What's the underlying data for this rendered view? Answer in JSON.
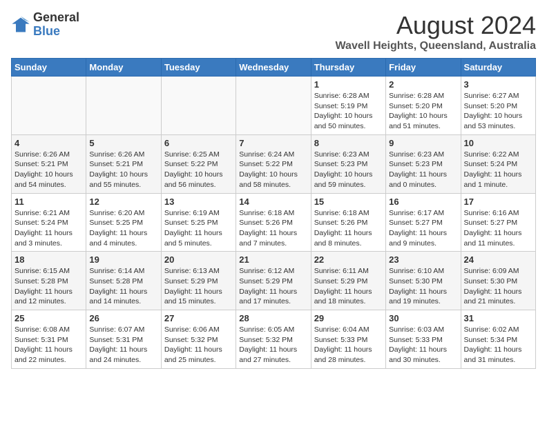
{
  "header": {
    "logo_line1": "General",
    "logo_line2": "Blue",
    "month": "August 2024",
    "location": "Wavell Heights, Queensland, Australia"
  },
  "days_of_week": [
    "Sunday",
    "Monday",
    "Tuesday",
    "Wednesday",
    "Thursday",
    "Friday",
    "Saturday"
  ],
  "weeks": [
    [
      {
        "num": "",
        "sunrise": "",
        "sunset": "",
        "daylight": ""
      },
      {
        "num": "",
        "sunrise": "",
        "sunset": "",
        "daylight": ""
      },
      {
        "num": "",
        "sunrise": "",
        "sunset": "",
        "daylight": ""
      },
      {
        "num": "",
        "sunrise": "",
        "sunset": "",
        "daylight": ""
      },
      {
        "num": "1",
        "sunrise": "Sunrise: 6:28 AM",
        "sunset": "Sunset: 5:19 PM",
        "daylight": "Daylight: 10 hours and 50 minutes."
      },
      {
        "num": "2",
        "sunrise": "Sunrise: 6:28 AM",
        "sunset": "Sunset: 5:20 PM",
        "daylight": "Daylight: 10 hours and 51 minutes."
      },
      {
        "num": "3",
        "sunrise": "Sunrise: 6:27 AM",
        "sunset": "Sunset: 5:20 PM",
        "daylight": "Daylight: 10 hours and 53 minutes."
      }
    ],
    [
      {
        "num": "4",
        "sunrise": "Sunrise: 6:26 AM",
        "sunset": "Sunset: 5:21 PM",
        "daylight": "Daylight: 10 hours and 54 minutes."
      },
      {
        "num": "5",
        "sunrise": "Sunrise: 6:26 AM",
        "sunset": "Sunset: 5:21 PM",
        "daylight": "Daylight: 10 hours and 55 minutes."
      },
      {
        "num": "6",
        "sunrise": "Sunrise: 6:25 AM",
        "sunset": "Sunset: 5:22 PM",
        "daylight": "Daylight: 10 hours and 56 minutes."
      },
      {
        "num": "7",
        "sunrise": "Sunrise: 6:24 AM",
        "sunset": "Sunset: 5:22 PM",
        "daylight": "Daylight: 10 hours and 58 minutes."
      },
      {
        "num": "8",
        "sunrise": "Sunrise: 6:23 AM",
        "sunset": "Sunset: 5:23 PM",
        "daylight": "Daylight: 10 hours and 59 minutes."
      },
      {
        "num": "9",
        "sunrise": "Sunrise: 6:23 AM",
        "sunset": "Sunset: 5:23 PM",
        "daylight": "Daylight: 11 hours and 0 minutes."
      },
      {
        "num": "10",
        "sunrise": "Sunrise: 6:22 AM",
        "sunset": "Sunset: 5:24 PM",
        "daylight": "Daylight: 11 hours and 1 minute."
      }
    ],
    [
      {
        "num": "11",
        "sunrise": "Sunrise: 6:21 AM",
        "sunset": "Sunset: 5:24 PM",
        "daylight": "Daylight: 11 hours and 3 minutes."
      },
      {
        "num": "12",
        "sunrise": "Sunrise: 6:20 AM",
        "sunset": "Sunset: 5:25 PM",
        "daylight": "Daylight: 11 hours and 4 minutes."
      },
      {
        "num": "13",
        "sunrise": "Sunrise: 6:19 AM",
        "sunset": "Sunset: 5:25 PM",
        "daylight": "Daylight: 11 hours and 5 minutes."
      },
      {
        "num": "14",
        "sunrise": "Sunrise: 6:18 AM",
        "sunset": "Sunset: 5:26 PM",
        "daylight": "Daylight: 11 hours and 7 minutes."
      },
      {
        "num": "15",
        "sunrise": "Sunrise: 6:18 AM",
        "sunset": "Sunset: 5:26 PM",
        "daylight": "Daylight: 11 hours and 8 minutes."
      },
      {
        "num": "16",
        "sunrise": "Sunrise: 6:17 AM",
        "sunset": "Sunset: 5:27 PM",
        "daylight": "Daylight: 11 hours and 9 minutes."
      },
      {
        "num": "17",
        "sunrise": "Sunrise: 6:16 AM",
        "sunset": "Sunset: 5:27 PM",
        "daylight": "Daylight: 11 hours and 11 minutes."
      }
    ],
    [
      {
        "num": "18",
        "sunrise": "Sunrise: 6:15 AM",
        "sunset": "Sunset: 5:28 PM",
        "daylight": "Daylight: 11 hours and 12 minutes."
      },
      {
        "num": "19",
        "sunrise": "Sunrise: 6:14 AM",
        "sunset": "Sunset: 5:28 PM",
        "daylight": "Daylight: 11 hours and 14 minutes."
      },
      {
        "num": "20",
        "sunrise": "Sunrise: 6:13 AM",
        "sunset": "Sunset: 5:29 PM",
        "daylight": "Daylight: 11 hours and 15 minutes."
      },
      {
        "num": "21",
        "sunrise": "Sunrise: 6:12 AM",
        "sunset": "Sunset: 5:29 PM",
        "daylight": "Daylight: 11 hours and 17 minutes."
      },
      {
        "num": "22",
        "sunrise": "Sunrise: 6:11 AM",
        "sunset": "Sunset: 5:29 PM",
        "daylight": "Daylight: 11 hours and 18 minutes."
      },
      {
        "num": "23",
        "sunrise": "Sunrise: 6:10 AM",
        "sunset": "Sunset: 5:30 PM",
        "daylight": "Daylight: 11 hours and 19 minutes."
      },
      {
        "num": "24",
        "sunrise": "Sunrise: 6:09 AM",
        "sunset": "Sunset: 5:30 PM",
        "daylight": "Daylight: 11 hours and 21 minutes."
      }
    ],
    [
      {
        "num": "25",
        "sunrise": "Sunrise: 6:08 AM",
        "sunset": "Sunset: 5:31 PM",
        "daylight": "Daylight: 11 hours and 22 minutes."
      },
      {
        "num": "26",
        "sunrise": "Sunrise: 6:07 AM",
        "sunset": "Sunset: 5:31 PM",
        "daylight": "Daylight: 11 hours and 24 minutes."
      },
      {
        "num": "27",
        "sunrise": "Sunrise: 6:06 AM",
        "sunset": "Sunset: 5:32 PM",
        "daylight": "Daylight: 11 hours and 25 minutes."
      },
      {
        "num": "28",
        "sunrise": "Sunrise: 6:05 AM",
        "sunset": "Sunset: 5:32 PM",
        "daylight": "Daylight: 11 hours and 27 minutes."
      },
      {
        "num": "29",
        "sunrise": "Sunrise: 6:04 AM",
        "sunset": "Sunset: 5:33 PM",
        "daylight": "Daylight: 11 hours and 28 minutes."
      },
      {
        "num": "30",
        "sunrise": "Sunrise: 6:03 AM",
        "sunset": "Sunset: 5:33 PM",
        "daylight": "Daylight: 11 hours and 30 minutes."
      },
      {
        "num": "31",
        "sunrise": "Sunrise: 6:02 AM",
        "sunset": "Sunset: 5:34 PM",
        "daylight": "Daylight: 11 hours and 31 minutes."
      }
    ]
  ]
}
